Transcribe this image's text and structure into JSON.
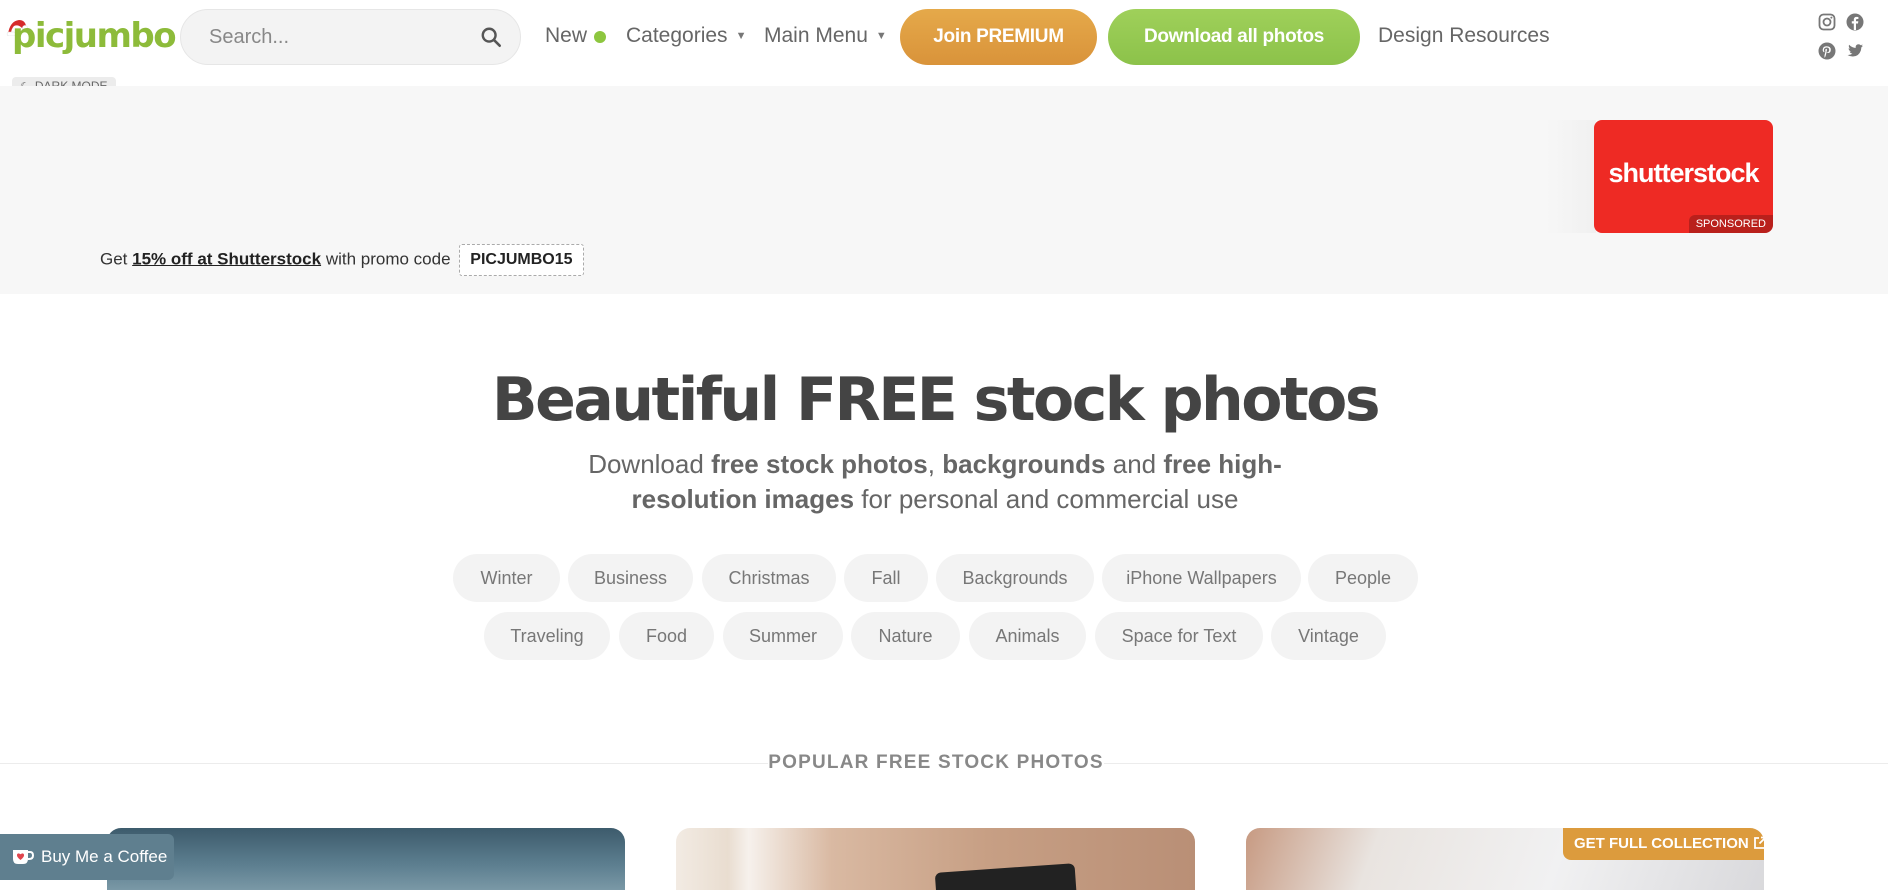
{
  "header": {
    "logo_text": "picjumbo",
    "search_placeholder": "Search...",
    "nav": {
      "new": "New",
      "categories": "Categories",
      "main_menu": "Main Menu",
      "design_resources": "Design Resources"
    },
    "join_premium": "Join PREMIUM",
    "download_all": "Download all photos",
    "dark_mode": "DARK MODE",
    "accent_green": "#8dbb3a",
    "accent_orange": "#d9933a"
  },
  "ad": {
    "brand": "shutterstock",
    "sponsored": "SPONSORED",
    "promo_prefix": "Get",
    "promo_link": "15% off at Shutterstock",
    "promo_middle": "with promo code",
    "promo_code": "PICJUMBO15"
  },
  "hero": {
    "title": "Beautiful FREE stock photos",
    "sub_1": "Download",
    "sub_2": "free stock photos",
    "sub_3": ",",
    "sub_4": "backgrounds",
    "sub_5": "and",
    "sub_6": "free high-resolution images",
    "sub_7": "for personal and commercial use"
  },
  "tags_row1": [
    "Winter",
    "Business",
    "Christmas",
    "Fall",
    "Backgrounds",
    "iPhone Wallpapers",
    "People"
  ],
  "tags_row2": [
    "Traveling",
    "Food",
    "Summer",
    "Nature",
    "Animals",
    "Space for Text",
    "Vintage"
  ],
  "section": {
    "title": "POPULAR FREE STOCK PHOTOS",
    "collection_button": "GET FULL COLLECTION"
  },
  "coffee": {
    "label": "Buy Me a Coffee"
  },
  "icons": [
    "search-icon",
    "instagram-icon",
    "facebook-icon",
    "pinterest-icon",
    "twitter-icon",
    "moon-icon",
    "external-link-icon",
    "coffee-cup-icon",
    "santa-hat-icon"
  ]
}
